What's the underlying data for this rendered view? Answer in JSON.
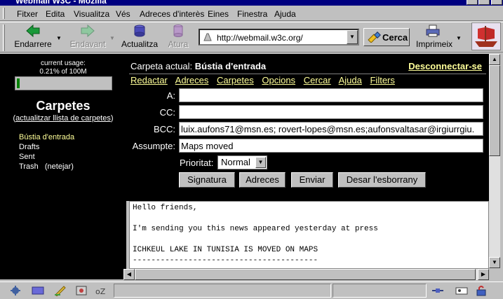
{
  "window": {
    "title": "Webmail W3C - Mozilla"
  },
  "menu": [
    "Fitxer",
    "Edita",
    "Visualitza",
    "Vés",
    "Adreces d'interès",
    "Eines",
    "Finestra",
    "Ajuda"
  ],
  "toolbar": {
    "back": "Endarrere",
    "forward": "Endavant",
    "reload": "Actualitza",
    "stop": "Atura",
    "url": "http://webmail.w3c.org/",
    "search": "Cerca",
    "print": "Imprimeix"
  },
  "sidebar": {
    "usage_label": "current usage:",
    "usage_value": "0.21% of 100M",
    "usage_fraction": 0.0021,
    "folders_title": "Carpetes",
    "refresh_link": "actualitzar llista de carpetes",
    "folders": [
      {
        "name": "Bústia d'entrada"
      },
      {
        "name": "Drafts"
      },
      {
        "name": "Sent"
      },
      {
        "name": "Trash",
        "extra": "(netejar)"
      }
    ]
  },
  "main": {
    "folder_prefix": "Carpeta actual:",
    "folder_name": "Bústia d'entrada",
    "logout": "Desconnectar-se",
    "nav": [
      "Redactar",
      "Adreces",
      "Carpetes",
      "Opcions",
      "Cercar",
      "Ajuda",
      "Filters"
    ],
    "fields": {
      "to_label": "A:",
      "to_value": "",
      "cc_label": "CC:",
      "cc_value": "",
      "bcc_label": "BCC:",
      "bcc_value": "luix.aufons71@msn.es; rovert-lopes@msn.es;aufonsvaltasar@irgiurrgiu.",
      "subject_label": "Assumpte:",
      "subject_value": "Maps moved"
    },
    "priority_label": "Prioritat:",
    "priority_value": "Normal",
    "buttons": [
      "Signatura",
      "Adreces",
      "Enviar",
      "Desar l'esborrany"
    ],
    "body": "Hello friends,\n\nI'm sending you this news appeared yesterday at press\n\nICHKEUL LAKE IN TUNISIA IS MOVED ON MAPS\n----------------------------------------"
  }
}
